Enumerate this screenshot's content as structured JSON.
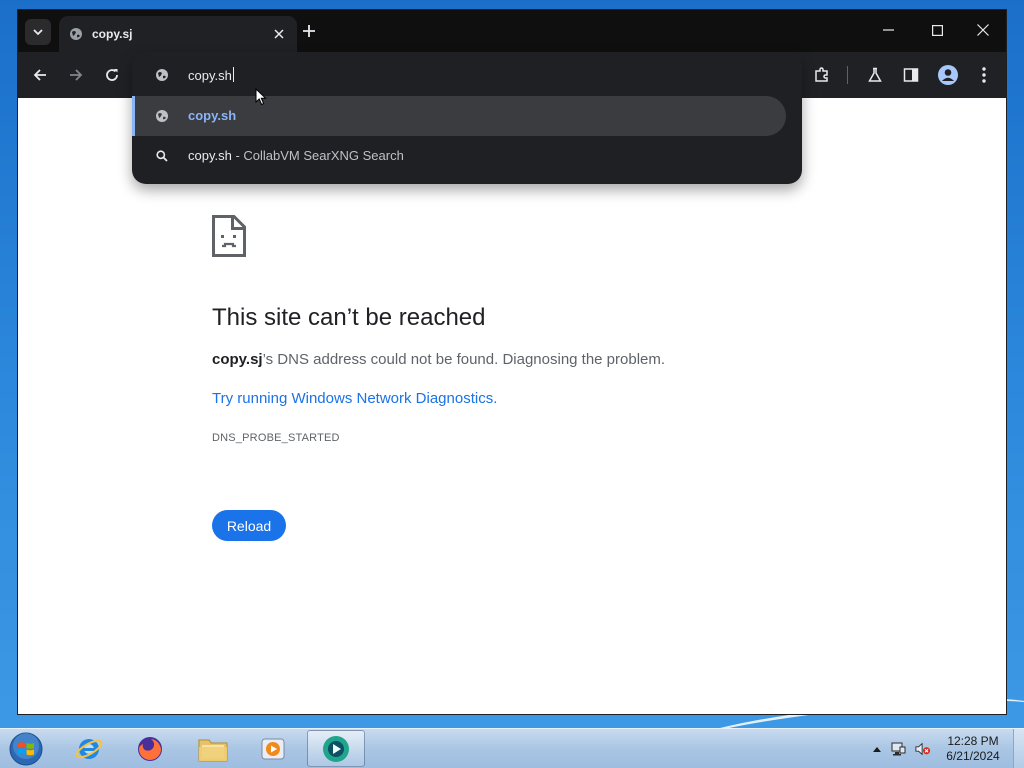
{
  "browser": {
    "tab": {
      "title": "copy.sj"
    },
    "omnibox": {
      "input_value": "copy.sh",
      "suggestions": [
        {
          "text": "copy.sh",
          "type": "url",
          "selected": true
        },
        {
          "text": "copy.sh",
          "suffix": " - CollabVM SearXNG Search",
          "type": "search"
        }
      ]
    }
  },
  "error_page": {
    "title": "This site can’t be reached",
    "host": "copy.sj",
    "description": "’s DNS address could not be found. Diagnosing the problem.",
    "diagnostics_link": "Try running Windows Network Diagnostics",
    "diagnostics_period": ".",
    "error_code": "DNS_PROBE_STARTED",
    "reload_label": "Reload"
  },
  "taskbar": {
    "apps": [
      "internet-explorer",
      "firefox",
      "file-explorer",
      "media-player",
      "browser-active"
    ],
    "clock": {
      "time": "12:28 PM",
      "date": "6/21/2024"
    }
  },
  "colors": {
    "accent": "#1a73e8",
    "omnibox_selected_text": "#8ab4f8",
    "toolbar_bg": "#202124"
  }
}
